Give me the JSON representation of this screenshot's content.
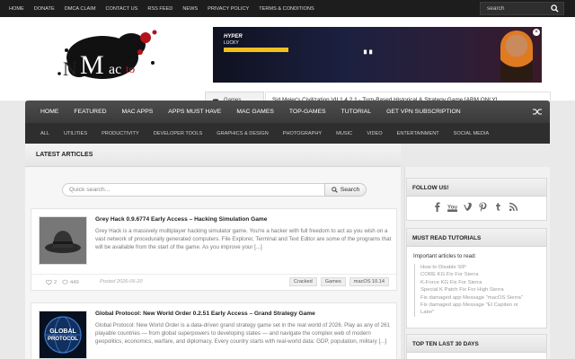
{
  "topnav": [
    "HOME",
    "DONATE",
    "DMCA CLAIM",
    "CONTACT US",
    "RSS FEED",
    "NEWS",
    "PRIVACY POLICY",
    "TERMS & CONDITIONS"
  ],
  "top_search": {
    "placeholder": "search"
  },
  "logo": {
    "text": "NMacTo"
  },
  "ticker": {
    "tab_label": "Games",
    "headline": "Sid Meier's Civilization VII 1.4.2.1 - Turn-Based Historical & Strategy Game [ARM ONLY]"
  },
  "mainnav": [
    "HOME",
    "FEATURED",
    "MAC APPS",
    "APPS MUST HAVE",
    "MAC GAMES",
    "TOP-GAMES",
    "TUTORIAL",
    "GET VPN SUBSCRIPTION"
  ],
  "subnav": [
    "ALL",
    "UTILITIES",
    "PRODUCTIVITY",
    "DEVELOPER TOOLS",
    "GRAPHICS & DESIGN",
    "PHOTOGRAPHY",
    "MUSIC",
    "VIDEO",
    "ENTERTAINMENT",
    "SOCIAL MEDIA"
  ],
  "latest": {
    "title": "LATEST ARTICLES"
  },
  "quick_search": {
    "placeholder": "Quick search...",
    "button": "Search"
  },
  "posts": [
    {
      "title": "Grey Hack 0.9.6774 Early Access – Hacking Simulation Game",
      "excerpt": "Grey Hack is a massively multiplayer hacking simulator game.   You're a hacker with full freedom to act as you wish on a vast network of procedurally generated computers.   File Explorer, Terminal and Text Editor are some of the programs that will be available from the start of the game. As you improve your [...]",
      "likes": "2",
      "views": "449",
      "date": "Posted 2026-06-20",
      "tags": [
        "Cracked",
        "Games",
        "macOS 10.14"
      ]
    },
    {
      "title": "Global Protocol: New World Order 0.2.51 Early Access – Grand Strategy Game",
      "excerpt": "Global Protocol: New World Order is a data-driven grand strategy game set in the real world of 2026. Play as any of 261 playable countries — from global superpowers to developing states — and navigate the complex web of modern geopolitics, economics, warfare, and diplomacy.   Every country starts with real-world data: GDP, population, military [...]",
      "thumb_text": [
        "GLOBAL",
        "PROTOCOL"
      ]
    }
  ],
  "sidebar": {
    "follow_title": "FOLLOW US!",
    "social_icons": [
      "facebook-icon",
      "youtube-icon",
      "vimeo-icon",
      "pinterest-icon",
      "tumblr-icon",
      "rss-icon"
    ],
    "must_title": "MUST READ TUTORIALS",
    "must_intro": "Important articles to read:",
    "must_items": [
      "How to Disable SIP",
      "CORE KG Fix For Sierra",
      "K-Force KG Fix For Sierra",
      "Special K Patch Fix For High Sierra",
      "Fix damaged app Message \"macOS Sierra\"",
      "Fix damaged app Message \"El Capitan or",
      "Later\""
    ],
    "top_title": "TOP TEN LAST 30 DAYS"
  },
  "colors": {
    "topbar": "#1d1d1d",
    "nav": "#3f3f3f",
    "subnav": "#2e2e2e",
    "page": "#e9e9e9"
  }
}
